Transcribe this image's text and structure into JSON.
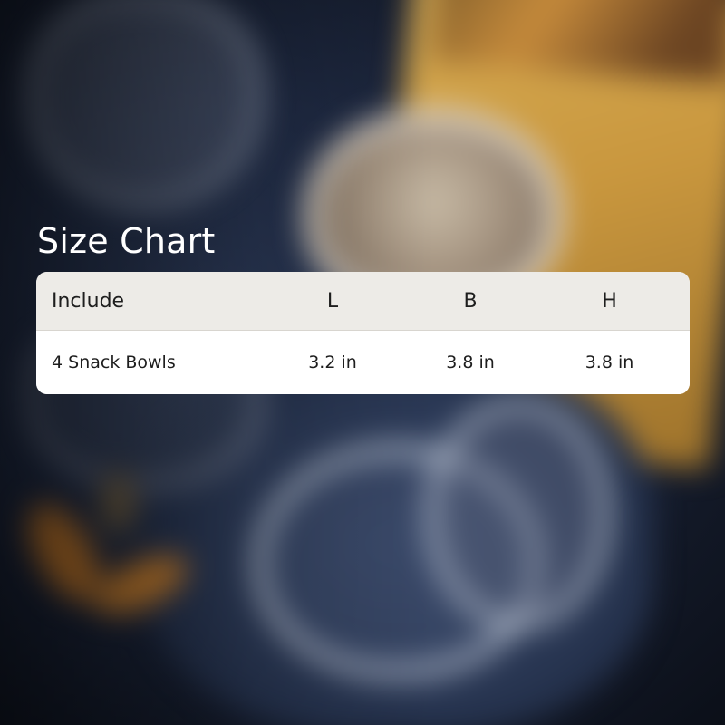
{
  "title": "Size Chart",
  "table": {
    "headers": [
      "Include",
      "L",
      "B",
      "H"
    ],
    "rows": [
      [
        "4 Snack Bowls",
        "3.2 in",
        "3.8 in",
        "3.8 in"
      ]
    ]
  },
  "colors": {
    "header_bg": "#edebe7",
    "body_bg": "#ffffff",
    "title_text": "#ffffff",
    "table_text": "#1e1e1e"
  }
}
